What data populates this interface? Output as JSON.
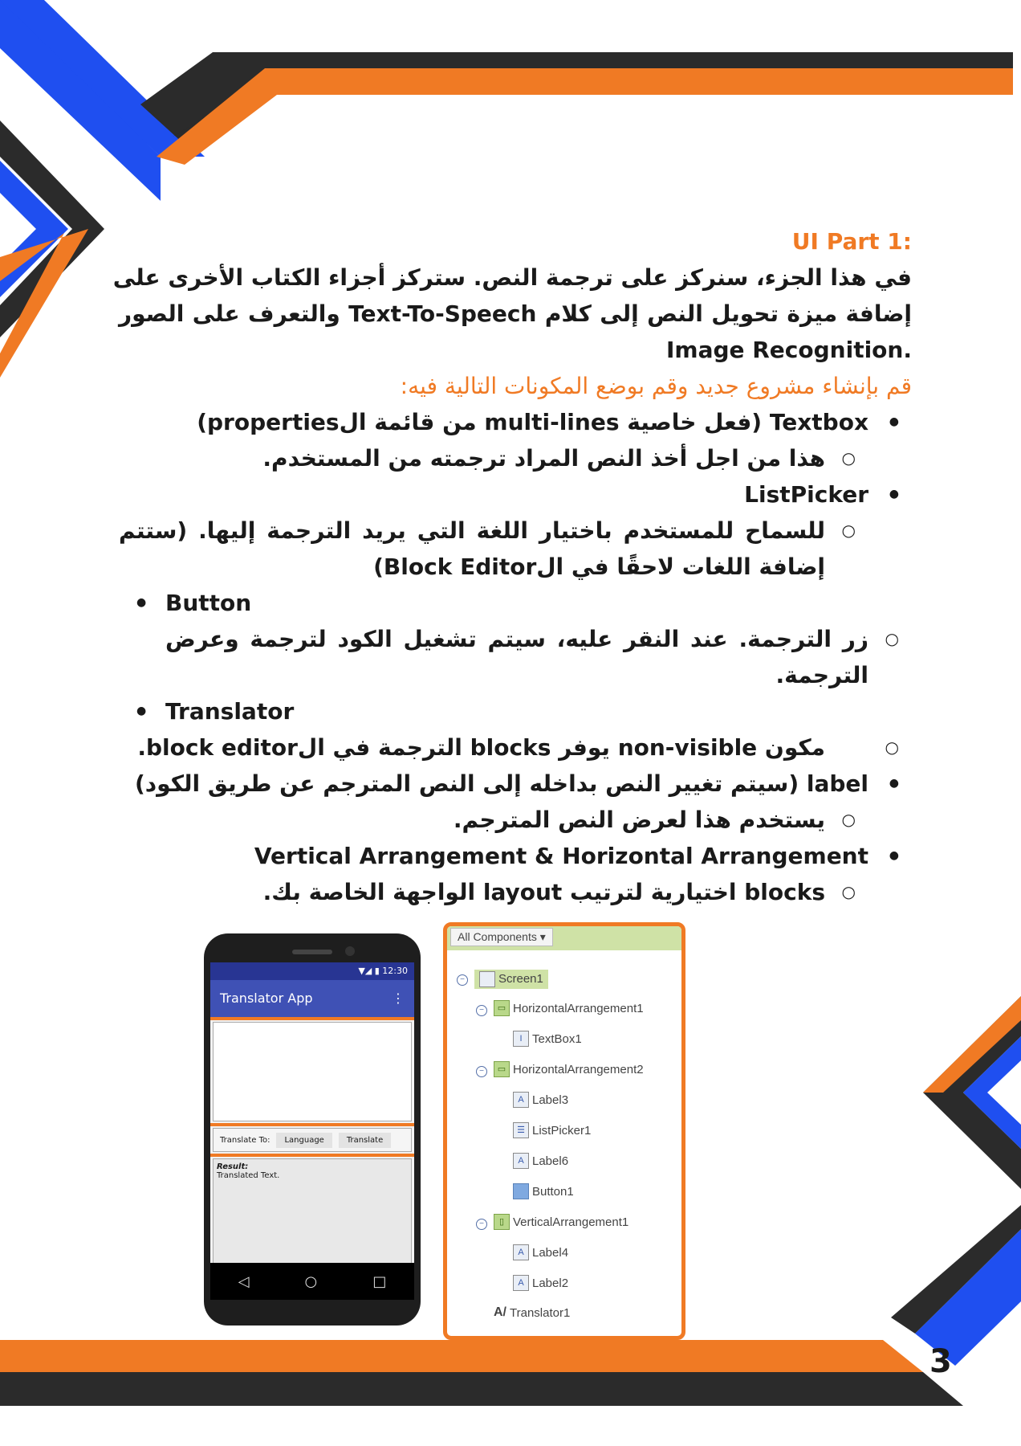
{
  "heading": ":UI Part 1",
  "intro": [
    "في هذا الجزء، سنركز على ترجمة النص. ستركز أجزاء الكتاب الأخرى على",
    "إضافة ميزة تحويل النص إلى كلام Text-To-Speech والتعرف على الصور",
    ".Image Recognition"
  ],
  "instruction": "قم بإنشاء مشروع جديد وقم بوضع المكونات التالية فيه:",
  "items": {
    "textbox": "Textbox (فعل خاصية multi-lines من قائمة الproperties)",
    "textbox_sub": "هذا من اجل أخذ النص المراد ترجمته من المستخدم.",
    "listpicker": "ListPicker",
    "listpicker_sub_1": "للسماح للمستخدم باختيار اللغة التي يريد الترجمة إليها. (ستتم",
    "listpicker_sub_2": "إضافة اللغات لاحقًا في الBlock Editor)",
    "button": "Button",
    "button_sub_1": "زر الترجمة. عند النقر عليه، سيتم تشغيل الكود لترجمة وعرض",
    "button_sub_2": "الترجمة.",
    "translator": "Translator",
    "translator_sub": "مكون non-visible يوفر blocks الترجمة في الblock editor.",
    "label": "label (سيتم تغيير النص بداخله إلى النص المترجم عن طريق الكود)",
    "label_sub": "يستخدم هذا لعرض النص المترجم.",
    "arrangement": "Vertical Arrangement & Horizontal Arrangement",
    "arrangement_sub": "blocks اختيارية لترتيب layout الواجهة الخاصة بك."
  },
  "phone": {
    "time": "12:30",
    "app_title": "Translator App",
    "menu_icon": "⋮",
    "translate_to_label": "Translate To:",
    "language_button": "Language",
    "translate_button": "Translate",
    "result_label": "Result:",
    "translated_text": "Translated Text.",
    "nav_back": "◁",
    "nav_home": "○",
    "nav_recent": "□"
  },
  "components": {
    "dropdown_label": "All Components ▾",
    "tree": [
      "Screen1",
      "HorizontalArrangement1",
      "TextBox1",
      "HorizontalArrangement2",
      "Label3",
      "ListPicker1",
      "Label6",
      "Button1",
      "VerticalArrangement1",
      "Label4",
      "Label2",
      "Translator1"
    ]
  },
  "page_number": "3",
  "colors": {
    "orange": "#f07a24",
    "blue": "#1f4ff0",
    "dark": "#2b2b2b"
  }
}
